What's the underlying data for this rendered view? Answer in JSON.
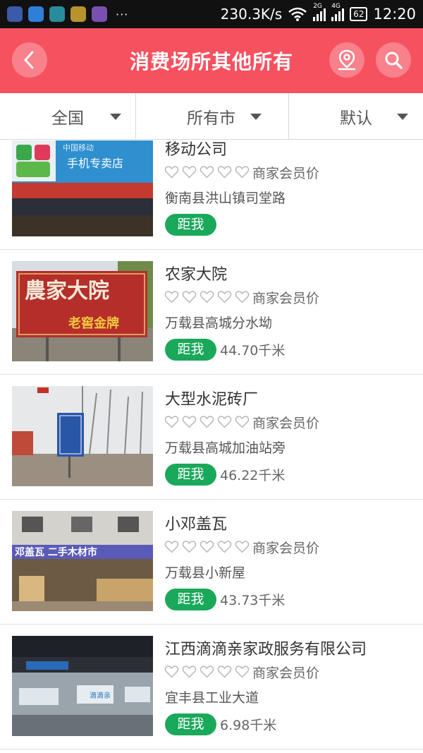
{
  "status_bar": {
    "speed": "230.3K/s",
    "net_a": "2G",
    "net_b": "4G",
    "battery": "62",
    "time": "12:20",
    "more": "···"
  },
  "header": {
    "title": "消费场所其他所有"
  },
  "filters": [
    {
      "label": "全国"
    },
    {
      "label": "所有市"
    },
    {
      "label": "默认"
    }
  ],
  "list_items": [
    {
      "name": "移动公司",
      "member": "商家会员价",
      "address": "衡南县洪山镇司堂路",
      "badge": "距我",
      "distance": "",
      "rating": 0
    },
    {
      "name": "农家大院",
      "member": "商家会员价",
      "address": "万载县高城分水坳",
      "badge": "距我",
      "distance": "44.70千米",
      "rating": 0
    },
    {
      "name": "大型水泥砖厂",
      "member": "商家会员价",
      "address": "万载县高城加油站旁",
      "badge": "距我",
      "distance": "46.22千米",
      "rating": 0
    },
    {
      "name": "小邓盖瓦",
      "member": "商家会员价",
      "address": "万载县小新屋",
      "badge": "距我",
      "distance": "43.73千米",
      "rating": 0
    },
    {
      "name": "江西滴滴亲家政服务有限公司",
      "member": "商家会员价",
      "address": "宜丰县工业大道",
      "badge": "距我",
      "distance": "6.98千米",
      "rating": 0
    }
  ],
  "photo_text": {
    "sign1_top": "中国移动",
    "sign1_main": "手机专卖店",
    "sign2_main": "農家大院",
    "sign2_sub": "老窖金牌",
    "sign4_main": "邓盖瓦  二手木材市",
    "sign5_logo": "滴滴亲"
  },
  "colors": {
    "primary": "#f6515f",
    "badge_green": "#1aa85a"
  }
}
